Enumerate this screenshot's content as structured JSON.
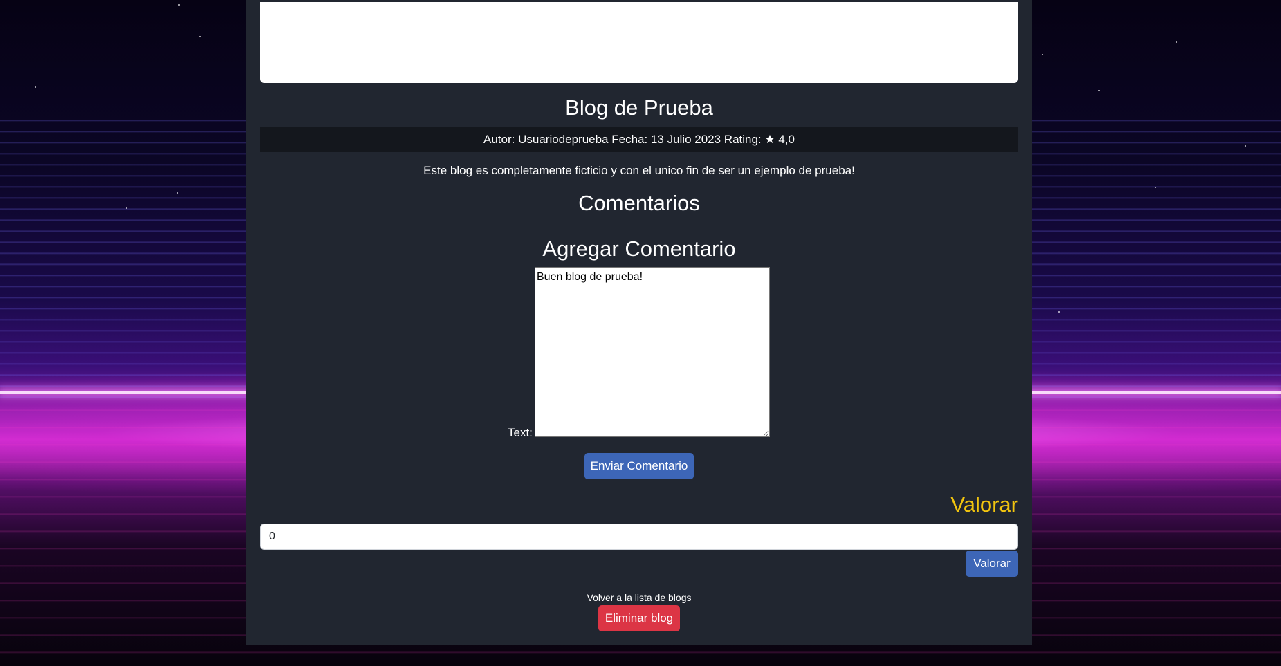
{
  "blog": {
    "title": "Blog de Prueba",
    "meta": "Autor: Usuariodeprueba Fecha: 13 Julio 2023 Rating: ★ 4,0",
    "description": "Este blog es completamente ficticio y con el unico fin de ser un ejemplo de prueba!"
  },
  "comments": {
    "title": "Comentarios"
  },
  "add_comment": {
    "title": "Agregar Comentario",
    "text_label": "Text:",
    "text_value": "Buen blog de prueba!",
    "submit_label": "Enviar Comentario"
  },
  "rating": {
    "title": "Valorar",
    "input_value": "0",
    "button_label": "Valorar"
  },
  "footer": {
    "back_link": "Volver a la lista de blogs",
    "delete_label": "Eliminar blog"
  },
  "colors": {
    "panel_bg": "#212630",
    "accent_blue": "#3d66b7",
    "danger_red": "#dc3545",
    "rate_title": "#f1c40f"
  }
}
